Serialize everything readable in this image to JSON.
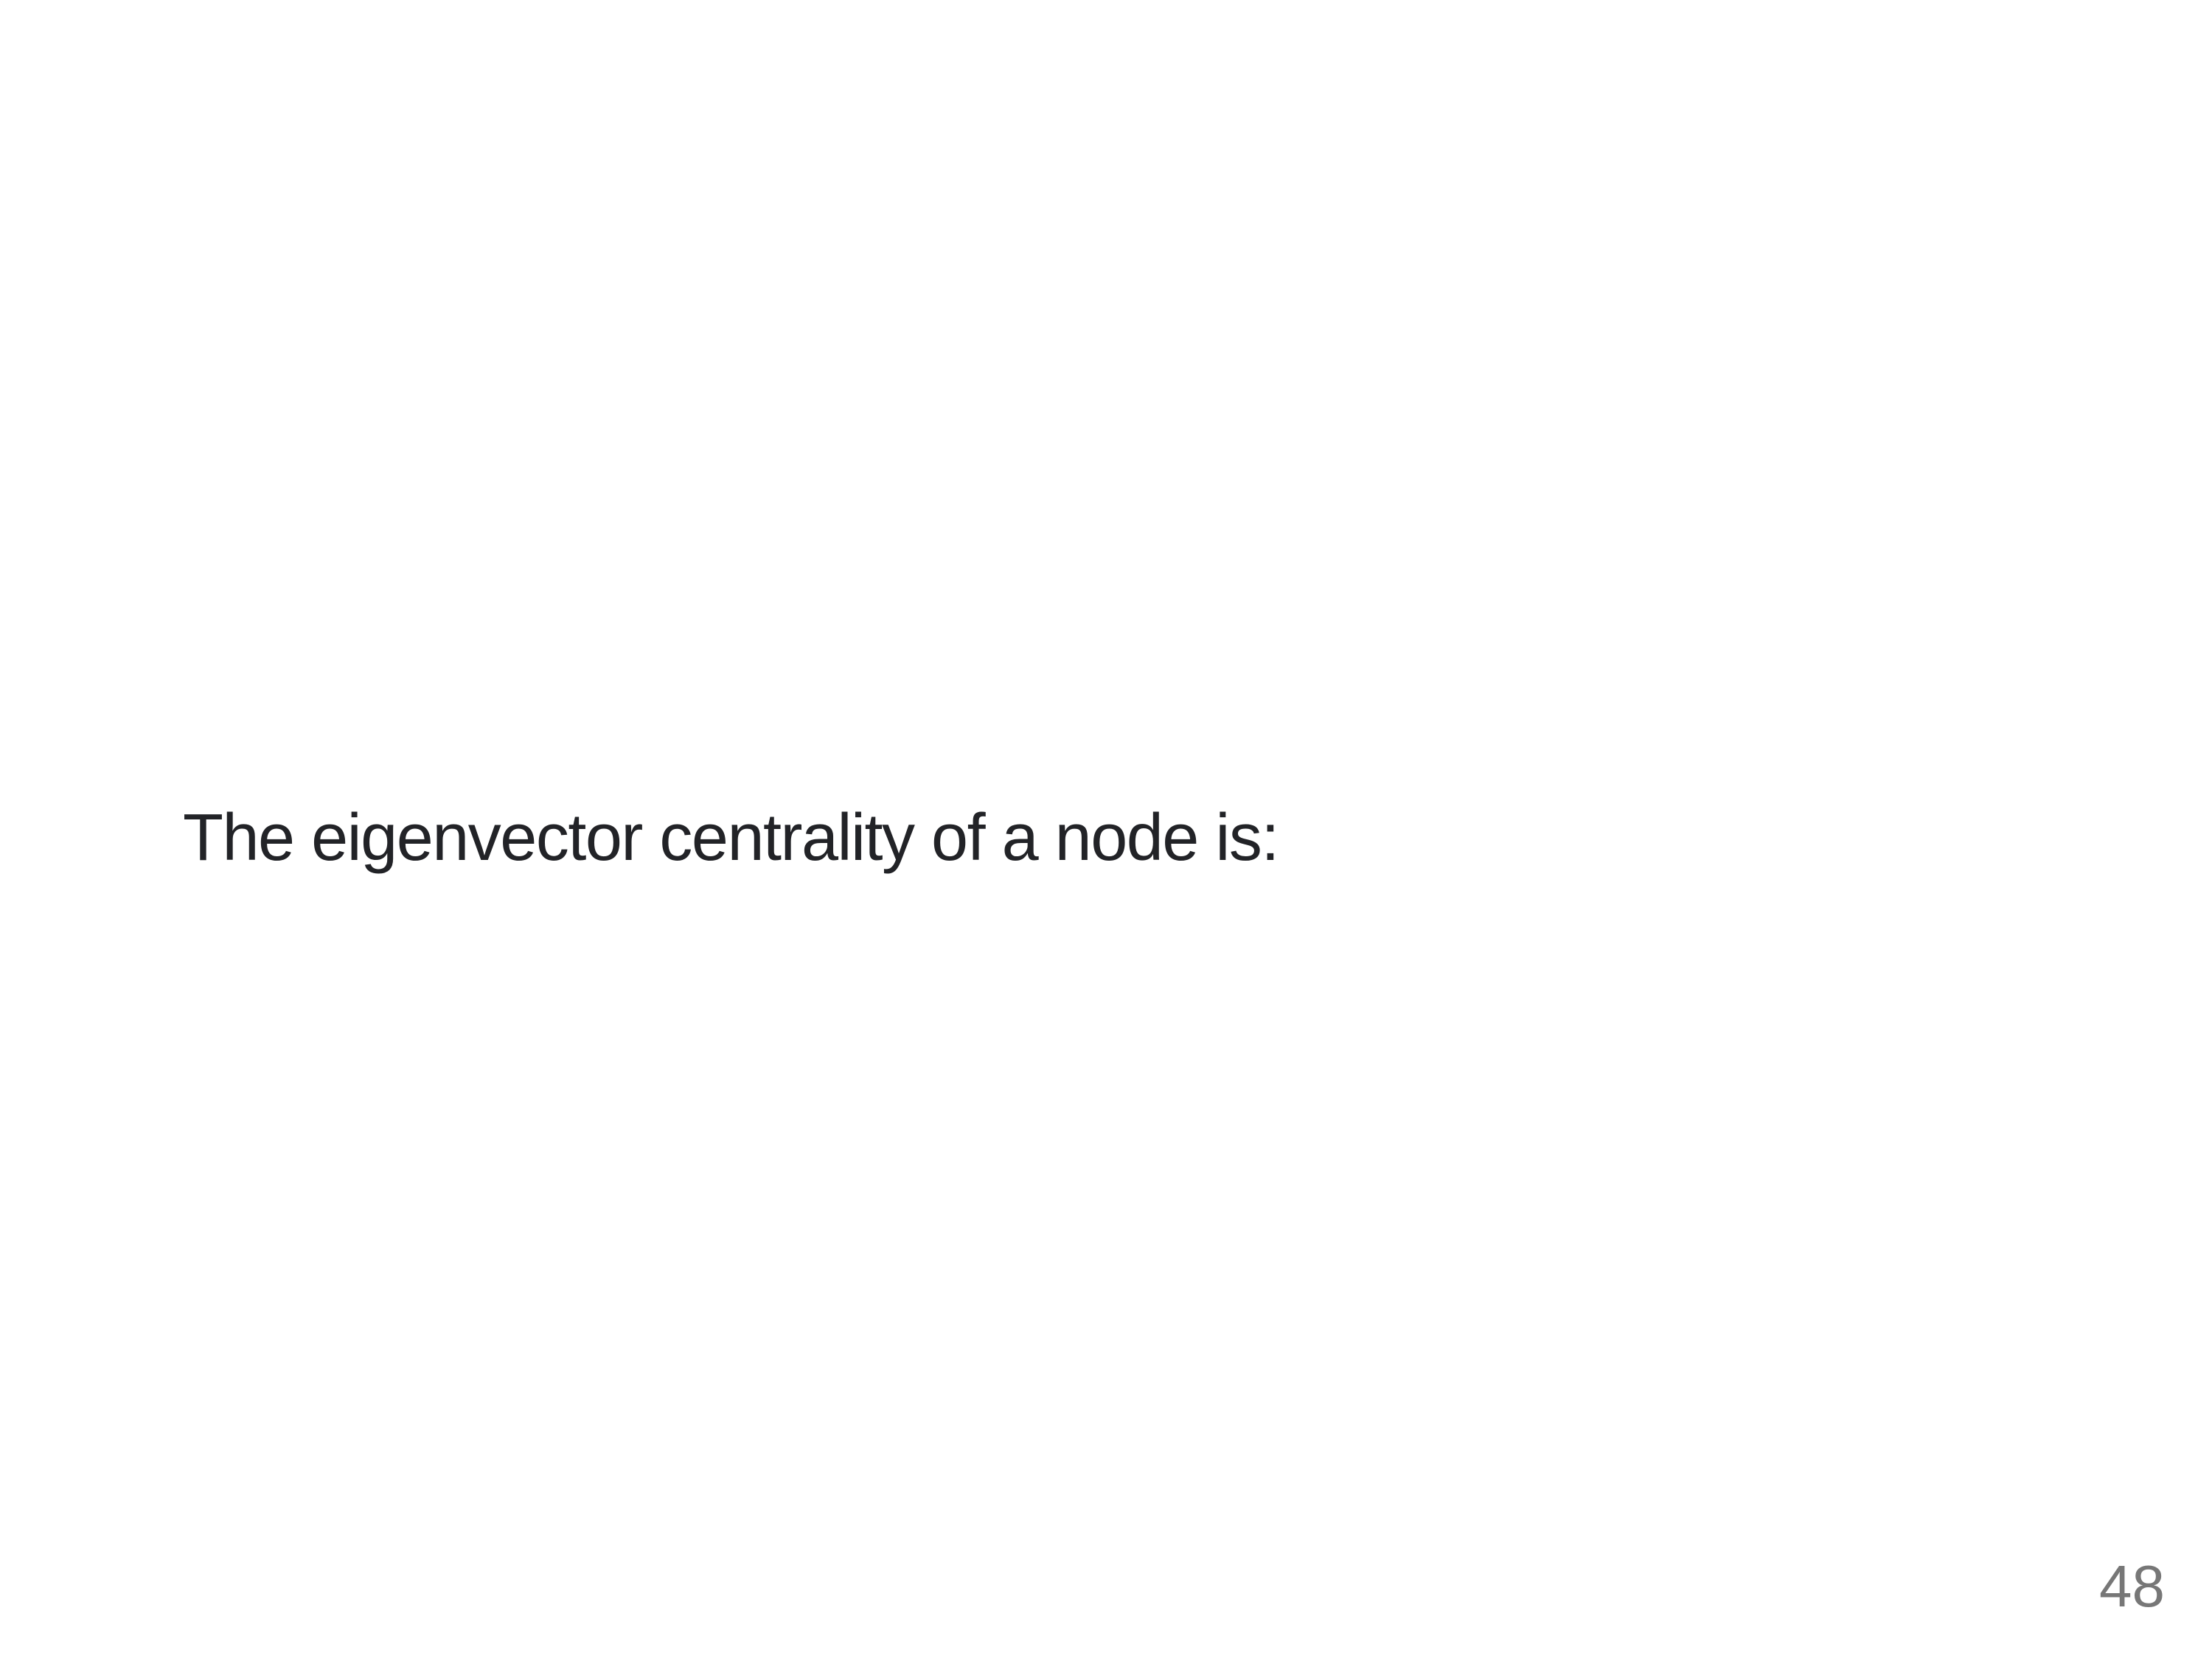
{
  "slide": {
    "text": "The eigenvector centrality of a node is:",
    "page_number": "48"
  }
}
